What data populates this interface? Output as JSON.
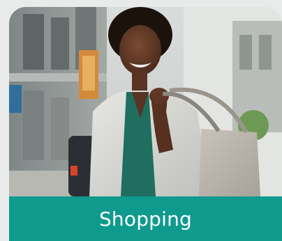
{
  "tile": {
    "label": "Shopping",
    "accent_color": "#0f9a8e",
    "label_color": "#ffffff",
    "image_description_icon": "shopping-photo"
  }
}
